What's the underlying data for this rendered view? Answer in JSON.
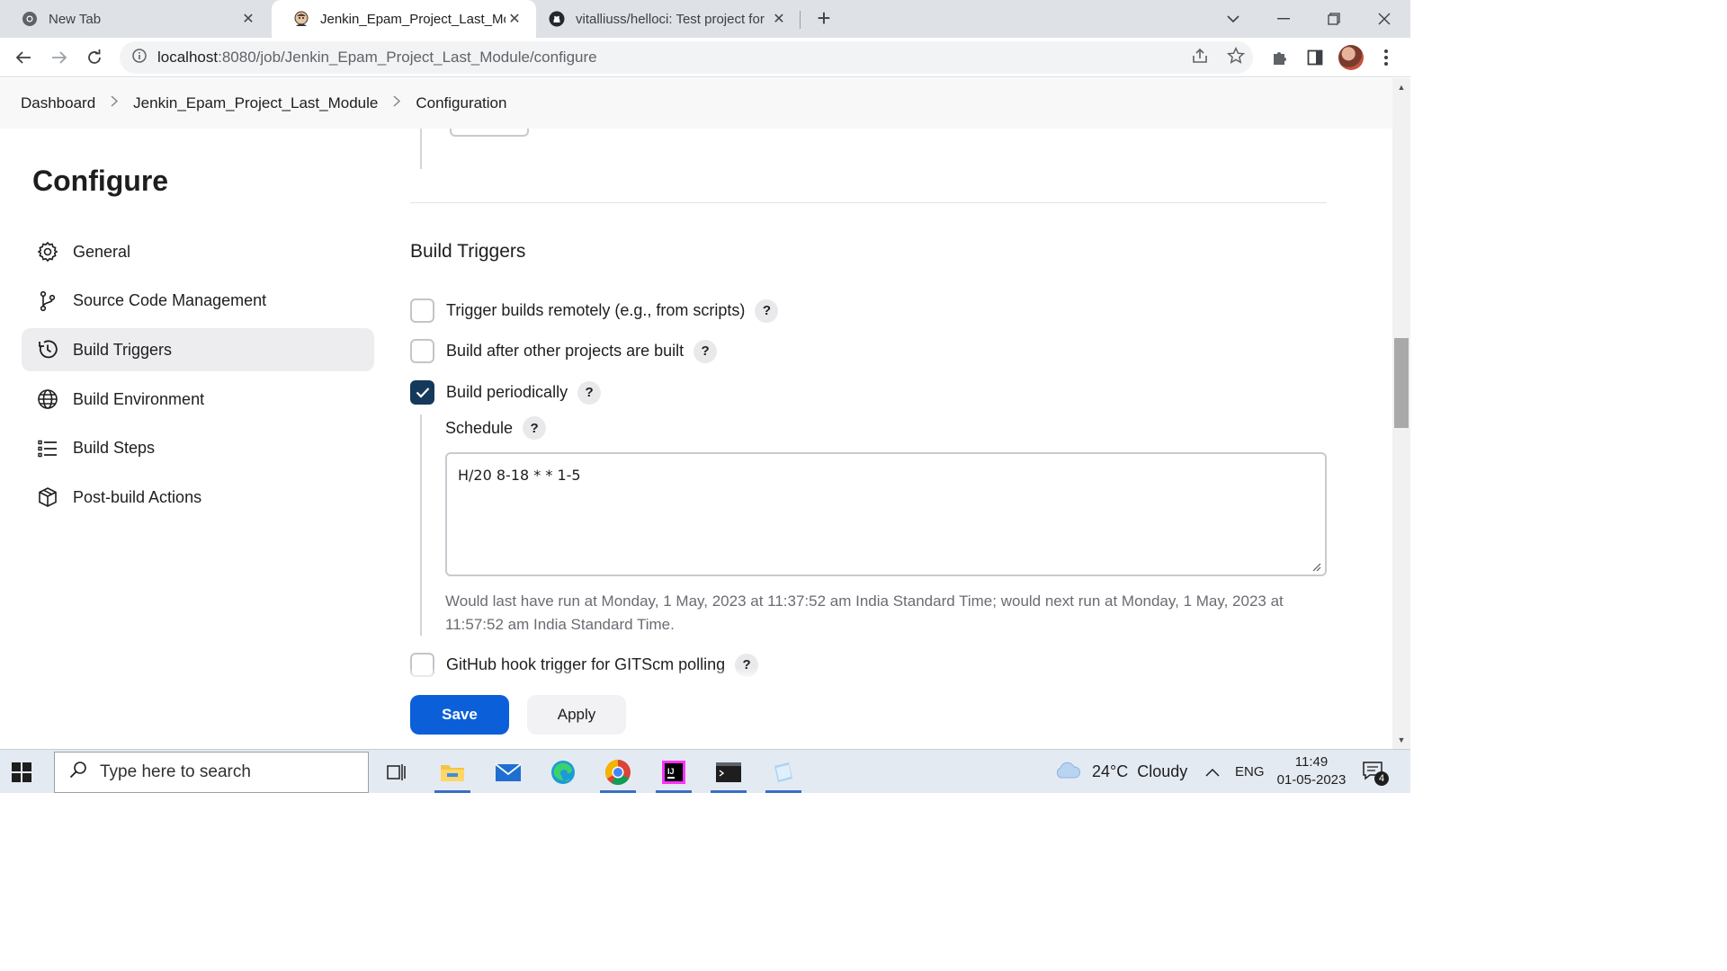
{
  "browser": {
    "tabs": [
      {
        "title": "New Tab",
        "active": false
      },
      {
        "title": "Jenkin_Epam_Project_Last_Module",
        "active": true
      },
      {
        "title": "vitalliuss/helloci: Test project for",
        "active": false
      }
    ],
    "url_host": "localhost",
    "url_path": ":8080/job/Jenkin_Epam_Project_Last_Module/configure"
  },
  "breadcrumb": {
    "items": [
      "Dashboard",
      "Jenkin_Epam_Project_Last_Module",
      "Configuration"
    ]
  },
  "sidebar": {
    "title": "Configure",
    "items": [
      {
        "label": "General",
        "icon": "gear-icon"
      },
      {
        "label": "Source Code Management",
        "icon": "branch-icon"
      },
      {
        "label": "Build Triggers",
        "icon": "clock-icon",
        "active": true
      },
      {
        "label": "Build Environment",
        "icon": "globe-icon"
      },
      {
        "label": "Build Steps",
        "icon": "list-icon"
      },
      {
        "label": "Post-build Actions",
        "icon": "package-icon"
      }
    ]
  },
  "main": {
    "section_title": "Build Triggers",
    "triggers": [
      {
        "label": "Trigger builds remotely (e.g., from scripts)",
        "checked": false
      },
      {
        "label": "Build after other projects are built",
        "checked": false
      },
      {
        "label": "Build periodically",
        "checked": true
      },
      {
        "label": "GitHub hook trigger for GITScm polling",
        "checked": false
      }
    ],
    "help_glyph": "?",
    "schedule": {
      "label": "Schedule",
      "value": "H/20 8-18 * * 1-5",
      "info": "Would last have run at Monday, 1 May, 2023 at 11:37:52 am India Standard Time; would next run at Monday, 1 May, 2023 at 11:57:52 am India Standard Time."
    },
    "buttons": {
      "save": "Save",
      "apply": "Apply"
    }
  },
  "taskbar": {
    "search_placeholder": "Type here to search",
    "weather_temp": "24°C",
    "weather_text": "Cloudy",
    "language": "ENG",
    "time": "11:49",
    "date": "01-05-2023",
    "notification_count": "4"
  },
  "colors": {
    "save_button": "#0b60d9",
    "checkbox_checked": "#14395b",
    "active_nav_bg": "#ededf0"
  }
}
